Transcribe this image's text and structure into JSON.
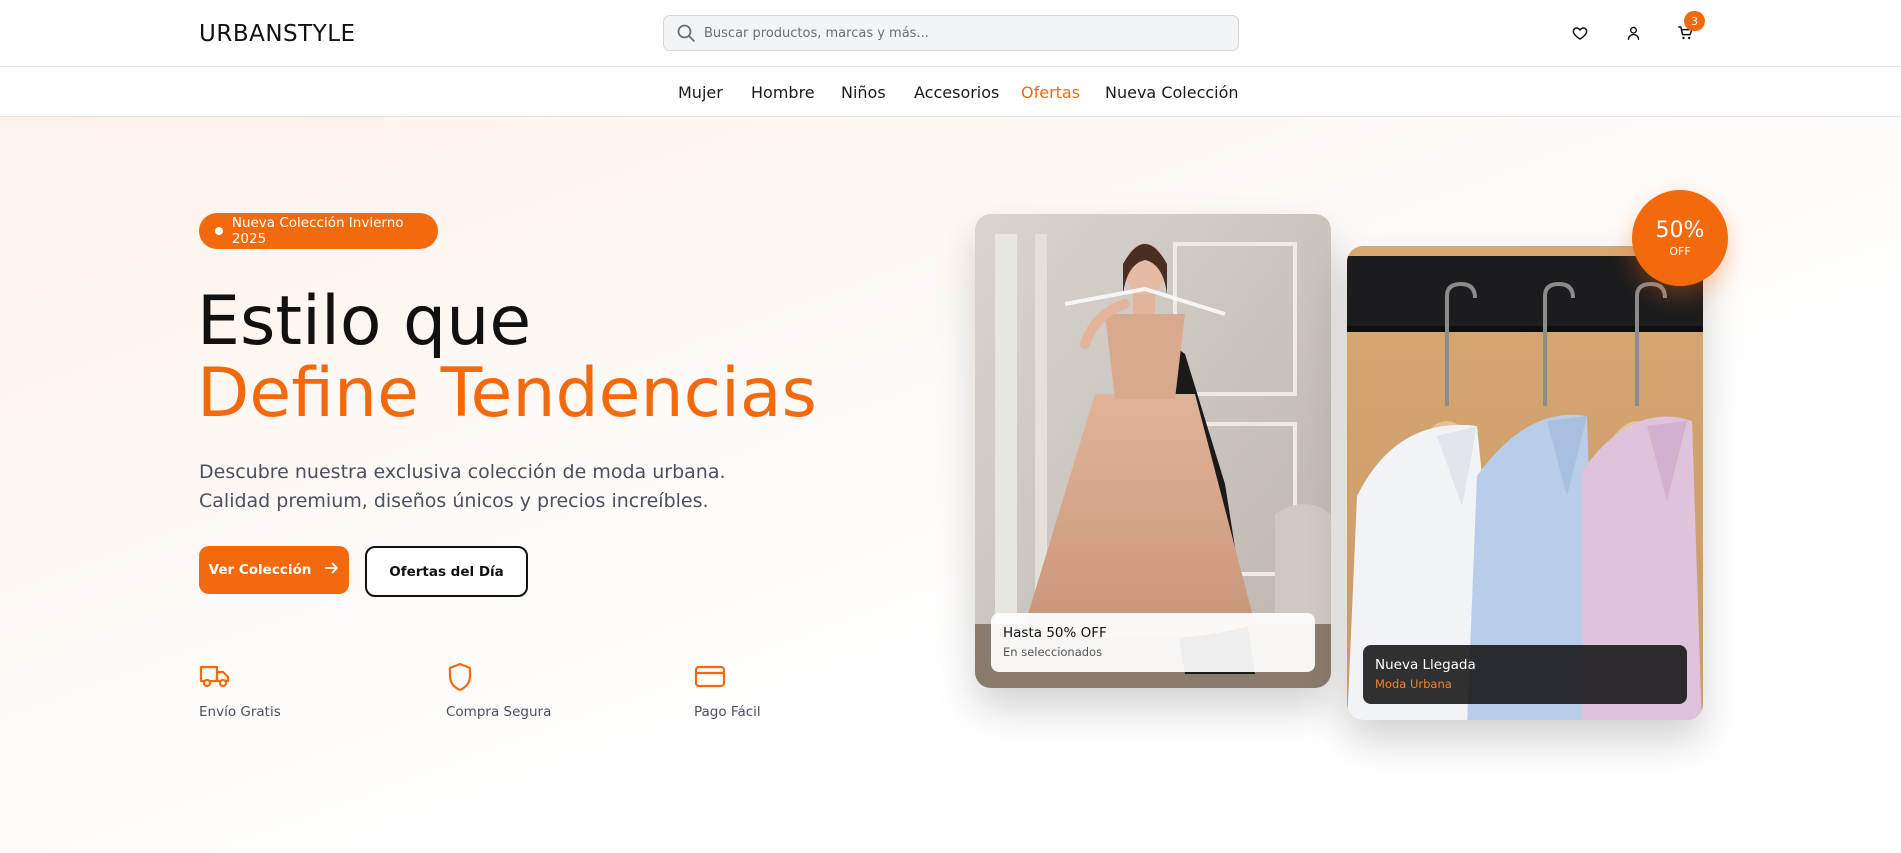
{
  "brand": {
    "name": "URBANSTYLE",
    "accent": "#f26a0d"
  },
  "search": {
    "placeholder": "Buscar productos, marcas y más...",
    "icon": "search-icon"
  },
  "header_icons": [
    {
      "name": "heart-icon"
    },
    {
      "name": "user-icon"
    },
    {
      "name": "cart-icon",
      "badge": "3"
    }
  ],
  "nav": {
    "items": [
      {
        "label": "Mujer",
        "active": false
      },
      {
        "label": "Hombre",
        "active": false
      },
      {
        "label": "Niños",
        "active": false
      },
      {
        "label": "Accesorios",
        "active": false
      },
      {
        "label": "Ofertas",
        "active": true
      },
      {
        "label": "Nueva Colección",
        "active": false
      }
    ]
  },
  "hero": {
    "pill": "Nueva Colección Invierno 2025",
    "title_line1": "Estilo que",
    "title_line2": "Define Tendencias",
    "subtitle_line1": "Descubre nuestra exclusiva colección de moda urbana.",
    "subtitle_line2": "Calidad premium, diseños únicos y precios increíbles.",
    "primary_button": "Ver Colección",
    "secondary_button": "Ofertas del Día",
    "features": [
      {
        "label": "Envío Gratis",
        "icon": "truck-icon"
      },
      {
        "label": "Compra Segura",
        "icon": "shield-icon"
      },
      {
        "label": "Pago Fácil",
        "icon": "credit-card-icon"
      }
    ]
  },
  "cards": [
    {
      "title": "Hasta 50% OFF",
      "subtitle": "En seleccionados"
    },
    {
      "title": "Nueva Llegada",
      "subtitle": "Moda Urbana"
    }
  ],
  "discount_badge": {
    "value": "50%",
    "label": "OFF"
  }
}
